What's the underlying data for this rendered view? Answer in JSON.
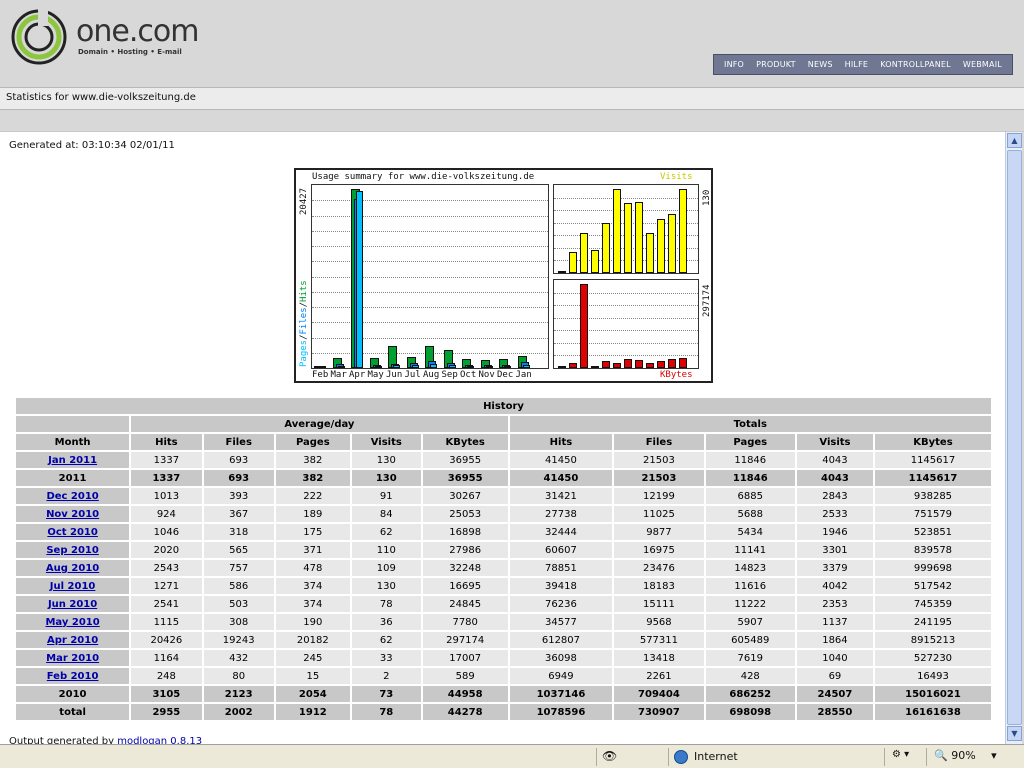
{
  "header": {
    "brand": "one.com",
    "tagline": "Domain • Hosting • E-mail",
    "nav": [
      "INFO",
      "PRODUKT",
      "NEWS",
      "HILFE",
      "KONTROLLPANEL",
      "WEBMAIL"
    ]
  },
  "stats_for": "Statistics for www.die-volkszeitung.de",
  "generated": "Generated at: 03:10:34 02/01/11",
  "chart": {
    "title": "Usage summary for www.die-volkszeitung.de",
    "left_scale": "20427",
    "visits_scale": "130",
    "kbytes_scale": "297174",
    "visits_label": "Visits",
    "kbytes_label": "KBytes",
    "left_axis_label": [
      "Pages",
      "/",
      "Files",
      "/",
      "Hits"
    ],
    "months": [
      "Feb",
      "Mar",
      "Apr",
      "May",
      "Jun",
      "Jul",
      "Aug",
      "Sep",
      "Oct",
      "Nov",
      "Dec",
      "Jan"
    ],
    "colors": {
      "hits": "#00a030",
      "files": "#0080ff",
      "pages": "#00c0ff",
      "visits": "#ffff00",
      "kbytes": "#e00000"
    }
  },
  "chart_data": {
    "type": "bar",
    "title": "Usage summary for www.die-volkszeitung.de",
    "categories": [
      "Feb",
      "Mar",
      "Apr",
      "May",
      "Jun",
      "Jul",
      "Aug",
      "Sep",
      "Oct",
      "Nov",
      "Dec",
      "Jan"
    ],
    "series": [
      {
        "name": "Hits",
        "values": [
          248,
          1164,
          20426,
          1115,
          2541,
          1271,
          2543,
          2020,
          1046,
          924,
          1013,
          1337
        ]
      },
      {
        "name": "Files",
        "values": [
          80,
          432,
          19243,
          308,
          503,
          586,
          757,
          565,
          318,
          367,
          393,
          693
        ]
      },
      {
        "name": "Pages",
        "values": [
          15,
          245,
          20182,
          190,
          374,
          374,
          478,
          371,
          175,
          189,
          222,
          382
        ]
      },
      {
        "name": "Visits",
        "values": [
          2,
          33,
          62,
          36,
          78,
          130,
          109,
          110,
          62,
          84,
          91,
          130
        ]
      },
      {
        "name": "KBytes",
        "values": [
          589,
          17007,
          297174,
          7780,
          24845,
          16695,
          32248,
          27986,
          16898,
          25053,
          30267,
          36955
        ]
      }
    ]
  },
  "table": {
    "title": "History",
    "group_avg": "Average/day",
    "group_tot": "Totals",
    "cols": [
      "Month",
      "Hits",
      "Files",
      "Pages",
      "Visits",
      "KBytes",
      "Hits",
      "Files",
      "Pages",
      "Visits",
      "KBytes"
    ],
    "rows": [
      {
        "m": "Jan 2011",
        "link": true,
        "v": [
          "1337",
          "693",
          "382",
          "130",
          "36955",
          "41450",
          "21503",
          "11846",
          "4043",
          "1145617"
        ]
      },
      {
        "m": "2011",
        "link": false,
        "v": [
          "1337",
          "693",
          "382",
          "130",
          "36955",
          "41450",
          "21503",
          "11846",
          "4043",
          "1145617"
        ]
      },
      {
        "m": "Dec 2010",
        "link": true,
        "v": [
          "1013",
          "393",
          "222",
          "91",
          "30267",
          "31421",
          "12199",
          "6885",
          "2843",
          "938285"
        ]
      },
      {
        "m": "Nov 2010",
        "link": true,
        "v": [
          "924",
          "367",
          "189",
          "84",
          "25053",
          "27738",
          "11025",
          "5688",
          "2533",
          "751579"
        ]
      },
      {
        "m": "Oct 2010",
        "link": true,
        "v": [
          "1046",
          "318",
          "175",
          "62",
          "16898",
          "32444",
          "9877",
          "5434",
          "1946",
          "523851"
        ]
      },
      {
        "m": "Sep 2010",
        "link": true,
        "v": [
          "2020",
          "565",
          "371",
          "110",
          "27986",
          "60607",
          "16975",
          "11141",
          "3301",
          "839578"
        ]
      },
      {
        "m": "Aug 2010",
        "link": true,
        "v": [
          "2543",
          "757",
          "478",
          "109",
          "32248",
          "78851",
          "23476",
          "14823",
          "3379",
          "999698"
        ]
      },
      {
        "m": "Jul 2010",
        "link": true,
        "v": [
          "1271",
          "586",
          "374",
          "130",
          "16695",
          "39418",
          "18183",
          "11616",
          "4042",
          "517542"
        ]
      },
      {
        "m": "Jun 2010",
        "link": true,
        "v": [
          "2541",
          "503",
          "374",
          "78",
          "24845",
          "76236",
          "15111",
          "11222",
          "2353",
          "745359"
        ]
      },
      {
        "m": "May 2010",
        "link": true,
        "v": [
          "1115",
          "308",
          "190",
          "36",
          "7780",
          "34577",
          "9568",
          "5907",
          "1137",
          "241195"
        ]
      },
      {
        "m": "Apr 2010",
        "link": true,
        "v": [
          "20426",
          "19243",
          "20182",
          "62",
          "297174",
          "612807",
          "577311",
          "605489",
          "1864",
          "8915213"
        ]
      },
      {
        "m": "Mar 2010",
        "link": true,
        "v": [
          "1164",
          "432",
          "245",
          "33",
          "17007",
          "36098",
          "13418",
          "7619",
          "1040",
          "527230"
        ]
      },
      {
        "m": "Feb 2010",
        "link": true,
        "v": [
          "248",
          "80",
          "15",
          "2",
          "589",
          "6949",
          "2261",
          "428",
          "69",
          "16493"
        ]
      },
      {
        "m": "2010",
        "link": false,
        "v": [
          "3105",
          "2123",
          "2054",
          "73",
          "44958",
          "1037146",
          "709404",
          "686252",
          "24507",
          "15016021"
        ]
      },
      {
        "m": "total",
        "link": false,
        "v": [
          "2955",
          "2002",
          "1912",
          "78",
          "44278",
          "1078596",
          "730907",
          "698098",
          "28550",
          "16161638"
        ]
      }
    ]
  },
  "output": {
    "prefix": "Output generated by",
    "link": "modlogan 0.8.13"
  },
  "statusbar": {
    "zone": "Internet",
    "zoom": "90%"
  }
}
